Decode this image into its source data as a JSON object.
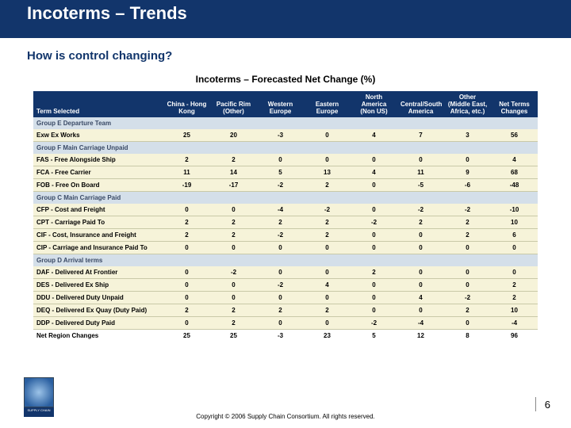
{
  "header": {
    "title": "Incoterms – Trends"
  },
  "subtitle": "How is control changing?",
  "chart_data": {
    "type": "table",
    "title": "Incoterms – Forecasted Net Change (%)",
    "term_header": "Term Selected",
    "columns": [
      "China - Hong Kong",
      "Pacific Rim (Other)",
      "Western Europe",
      "Eastern Europe",
      "North America (Non US)",
      "Central/South America",
      "Other (Middle East, Africa, etc.)",
      "Net Terms Changes"
    ],
    "groups": [
      {
        "label": "Group E Departure Team",
        "rows": [
          {
            "label": "Exw Ex Works",
            "v": [
              25,
              20,
              -3,
              0,
              4,
              7,
              3,
              56
            ]
          }
        ]
      },
      {
        "label": "Group F Main Carriage Unpaid",
        "rows": [
          {
            "label": "FAS - Free Alongside Ship",
            "v": [
              2,
              2,
              0,
              0,
              0,
              0,
              0,
              4
            ]
          },
          {
            "label": "FCA - Free Carrier",
            "v": [
              11,
              14,
              5,
              13,
              4,
              11,
              9,
              68
            ]
          },
          {
            "label": "FOB - Free On Board",
            "v": [
              -19,
              -17,
              -2,
              2,
              0,
              -5,
              -6,
              -48
            ]
          }
        ]
      },
      {
        "label": "Group C Main Carriage Paid",
        "rows": [
          {
            "label": "CFP - Cost and Freight",
            "v": [
              0,
              0,
              -4,
              -2,
              0,
              -2,
              -2,
              -10
            ]
          },
          {
            "label": "CPT - Carriage Paid To",
            "v": [
              2,
              2,
              2,
              2,
              -2,
              2,
              2,
              10
            ]
          },
          {
            "label": "CIF - Cost, Insurance and Freight",
            "v": [
              2,
              2,
              -2,
              2,
              0,
              0,
              2,
              6
            ]
          },
          {
            "label": "CIP - Carriage and Insurance Paid To",
            "v": [
              0,
              0,
              0,
              0,
              0,
              0,
              0,
              0
            ]
          }
        ]
      },
      {
        "label": "Group D Arrival terms",
        "rows": [
          {
            "label": "DAF - Delivered At Frontier",
            "v": [
              0,
              -2,
              0,
              0,
              2,
              0,
              0,
              0
            ]
          },
          {
            "label": "DES - Delivered Ex Ship",
            "v": [
              0,
              0,
              -2,
              4,
              0,
              0,
              0,
              2
            ]
          },
          {
            "label": "DDU - Delivered Duty Unpaid",
            "v": [
              0,
              0,
              0,
              0,
              0,
              4,
              -2,
              2
            ]
          },
          {
            "label": "DEQ - Delivered Ex Quay (Duty Paid)",
            "v": [
              2,
              2,
              2,
              2,
              0,
              0,
              2,
              10
            ]
          },
          {
            "label": "DDP - Delivered Duty Paid",
            "v": [
              0,
              2,
              0,
              0,
              -2,
              -4,
              0,
              -4
            ]
          }
        ]
      }
    ],
    "net_row": {
      "label": "Net Region Changes",
      "v": [
        25,
        25,
        -3,
        23,
        5,
        12,
        8,
        96
      ]
    }
  },
  "logo": {
    "text": "SUPPLY CHAIN"
  },
  "footer": {
    "copyright": "Copyright © 2006 Supply Chain Consortium. All rights reserved."
  },
  "page": {
    "number": "6"
  }
}
